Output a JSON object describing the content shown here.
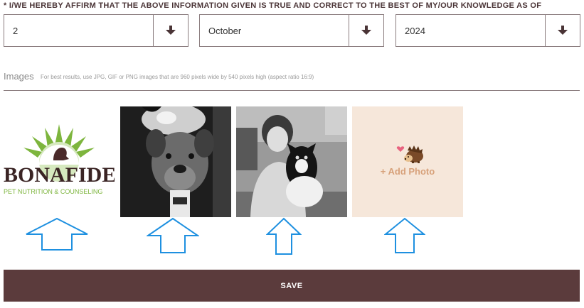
{
  "affirm_text": "* I/WE HEREBY AFFIRM THAT THE ABOVE INFORMATION GIVEN IS TRUE AND CORRECT TO THE BEST OF MY/OUR KNOWLEDGE AS OF",
  "date": {
    "day": "2",
    "month": "October",
    "year": "2024"
  },
  "images": {
    "label": "Images",
    "hint": "For best results, use JPG, GIF or PNG images that are 960 pixels wide by 540 pixels high (aspect ratio 16:9)",
    "logo_text": "BONAFIDE",
    "logo_subtext": "PET NUTRITION & COUNSELING",
    "add_photo_label": "+ Add Photo"
  },
  "save_label": "SAVE",
  "colors": {
    "brand": "#5b3b3c",
    "add_tile": "#f6e7da",
    "add_label": "#d7a17a",
    "arrow": "#1e90e0",
    "logo_green": "#7db53d"
  }
}
